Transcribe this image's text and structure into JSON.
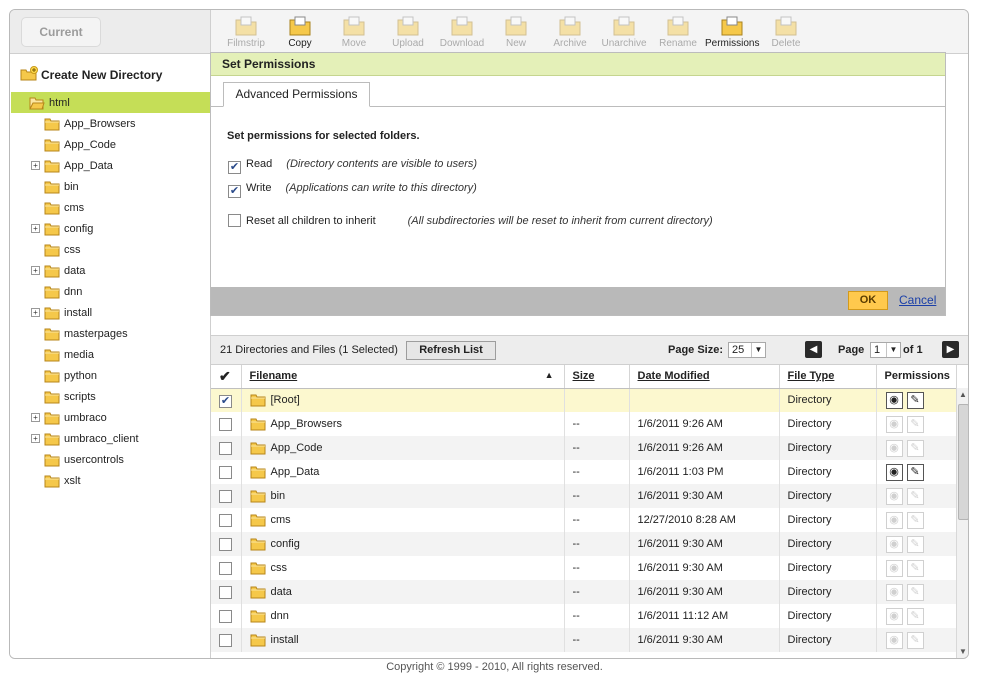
{
  "header": {
    "current_label": "Current"
  },
  "toolbar": {
    "items": [
      {
        "label": "Filmstrip",
        "icon": "filmstrip-icon",
        "enabled": false
      },
      {
        "label": "Copy",
        "icon": "copy-folder-icon",
        "enabled": true
      },
      {
        "label": "Move",
        "icon": "move-folder-icon",
        "enabled": false
      },
      {
        "label": "Upload",
        "icon": "upload-icon",
        "enabled": false
      },
      {
        "label": "Download",
        "icon": "download-icon",
        "enabled": false
      },
      {
        "label": "New",
        "icon": "new-file-icon",
        "enabled": false
      },
      {
        "label": "Archive",
        "icon": "archive-icon",
        "enabled": false
      },
      {
        "label": "Unarchive",
        "icon": "unarchive-icon",
        "enabled": false
      },
      {
        "label": "Rename",
        "icon": "rename-icon",
        "enabled": false
      },
      {
        "label": "Permissions",
        "icon": "permissions-lock-icon",
        "enabled": true
      },
      {
        "label": "Delete",
        "icon": "delete-icon",
        "enabled": false
      }
    ]
  },
  "sidebar": {
    "create_new": "Create New Directory",
    "root": "html",
    "items": [
      {
        "label": "App_Browsers",
        "expandable": false
      },
      {
        "label": "App_Code",
        "expandable": false
      },
      {
        "label": "App_Data",
        "expandable": true
      },
      {
        "label": "bin",
        "expandable": false
      },
      {
        "label": "cms",
        "expandable": false
      },
      {
        "label": "config",
        "expandable": true
      },
      {
        "label": "css",
        "expandable": false
      },
      {
        "label": "data",
        "expandable": true
      },
      {
        "label": "dnn",
        "expandable": false
      },
      {
        "label": "install",
        "expandable": true
      },
      {
        "label": "masterpages",
        "expandable": false
      },
      {
        "label": "media",
        "expandable": false
      },
      {
        "label": "python",
        "expandable": false
      },
      {
        "label": "scripts",
        "expandable": false
      },
      {
        "label": "umbraco",
        "expandable": true
      },
      {
        "label": "umbraco_client",
        "expandable": true
      },
      {
        "label": "usercontrols",
        "expandable": false
      },
      {
        "label": "xslt",
        "expandable": false
      }
    ]
  },
  "permissions_panel": {
    "title": "Set Permissions",
    "tab": "Advanced Permissions",
    "message": "Set permissions for selected folders.",
    "read_label": "Read",
    "read_hint": "(Directory contents are visible to users)",
    "write_label": "Write",
    "write_hint": "(Applications can write to this directory)",
    "reset_label": "Reset all children to inherit",
    "reset_hint": "(All subdirectories will be reset to inherit from current directory)",
    "ok": "OK",
    "cancel": "Cancel"
  },
  "list": {
    "count_text": "21 Directories and Files (1 Selected)",
    "refresh": "Refresh List",
    "page_size_label": "Page Size:",
    "page_size": "25",
    "page_label": "Page",
    "page": "1",
    "of_text": "of 1",
    "columns": {
      "filename": "Filename",
      "size": "Size",
      "modified": "Date Modified",
      "type": "File Type",
      "permissions": "Permissions"
    },
    "rows": [
      {
        "name": "[Root]",
        "size": "",
        "modified": "",
        "type": "Directory",
        "checked": true,
        "perm_active": true
      },
      {
        "name": "App_Browsers",
        "size": "--",
        "modified": "1/6/2011 9:26 AM",
        "type": "Directory",
        "checked": false,
        "perm_active": false
      },
      {
        "name": "App_Code",
        "size": "--",
        "modified": "1/6/2011 9:26 AM",
        "type": "Directory",
        "checked": false,
        "perm_active": false
      },
      {
        "name": "App_Data",
        "size": "--",
        "modified": "1/6/2011 1:03 PM",
        "type": "Directory",
        "checked": false,
        "perm_active": true
      },
      {
        "name": "bin",
        "size": "--",
        "modified": "1/6/2011 9:30 AM",
        "type": "Directory",
        "checked": false,
        "perm_active": false
      },
      {
        "name": "cms",
        "size": "--",
        "modified": "12/27/2010 8:28 AM",
        "type": "Directory",
        "checked": false,
        "perm_active": false
      },
      {
        "name": "config",
        "size": "--",
        "modified": "1/6/2011 9:30 AM",
        "type": "Directory",
        "checked": false,
        "perm_active": false
      },
      {
        "name": "css",
        "size": "--",
        "modified": "1/6/2011 9:30 AM",
        "type": "Directory",
        "checked": false,
        "perm_active": false
      },
      {
        "name": "data",
        "size": "--",
        "modified": "1/6/2011 9:30 AM",
        "type": "Directory",
        "checked": false,
        "perm_active": false
      },
      {
        "name": "dnn",
        "size": "--",
        "modified": "1/6/2011 11:12 AM",
        "type": "Directory",
        "checked": false,
        "perm_active": false
      },
      {
        "name": "install",
        "size": "--",
        "modified": "1/6/2011 9:30 AM",
        "type": "Directory",
        "checked": false,
        "perm_active": false
      }
    ]
  },
  "footer": {
    "copyright": "Copyright © 1999 - 2010, All rights reserved."
  },
  "colors": {
    "accent_green": "#c5de57",
    "panel_head": "#e4f0b8",
    "ok_button": "#ffc94d",
    "link": "#1a3fa8",
    "highlight_row": "#fcf8cf"
  }
}
